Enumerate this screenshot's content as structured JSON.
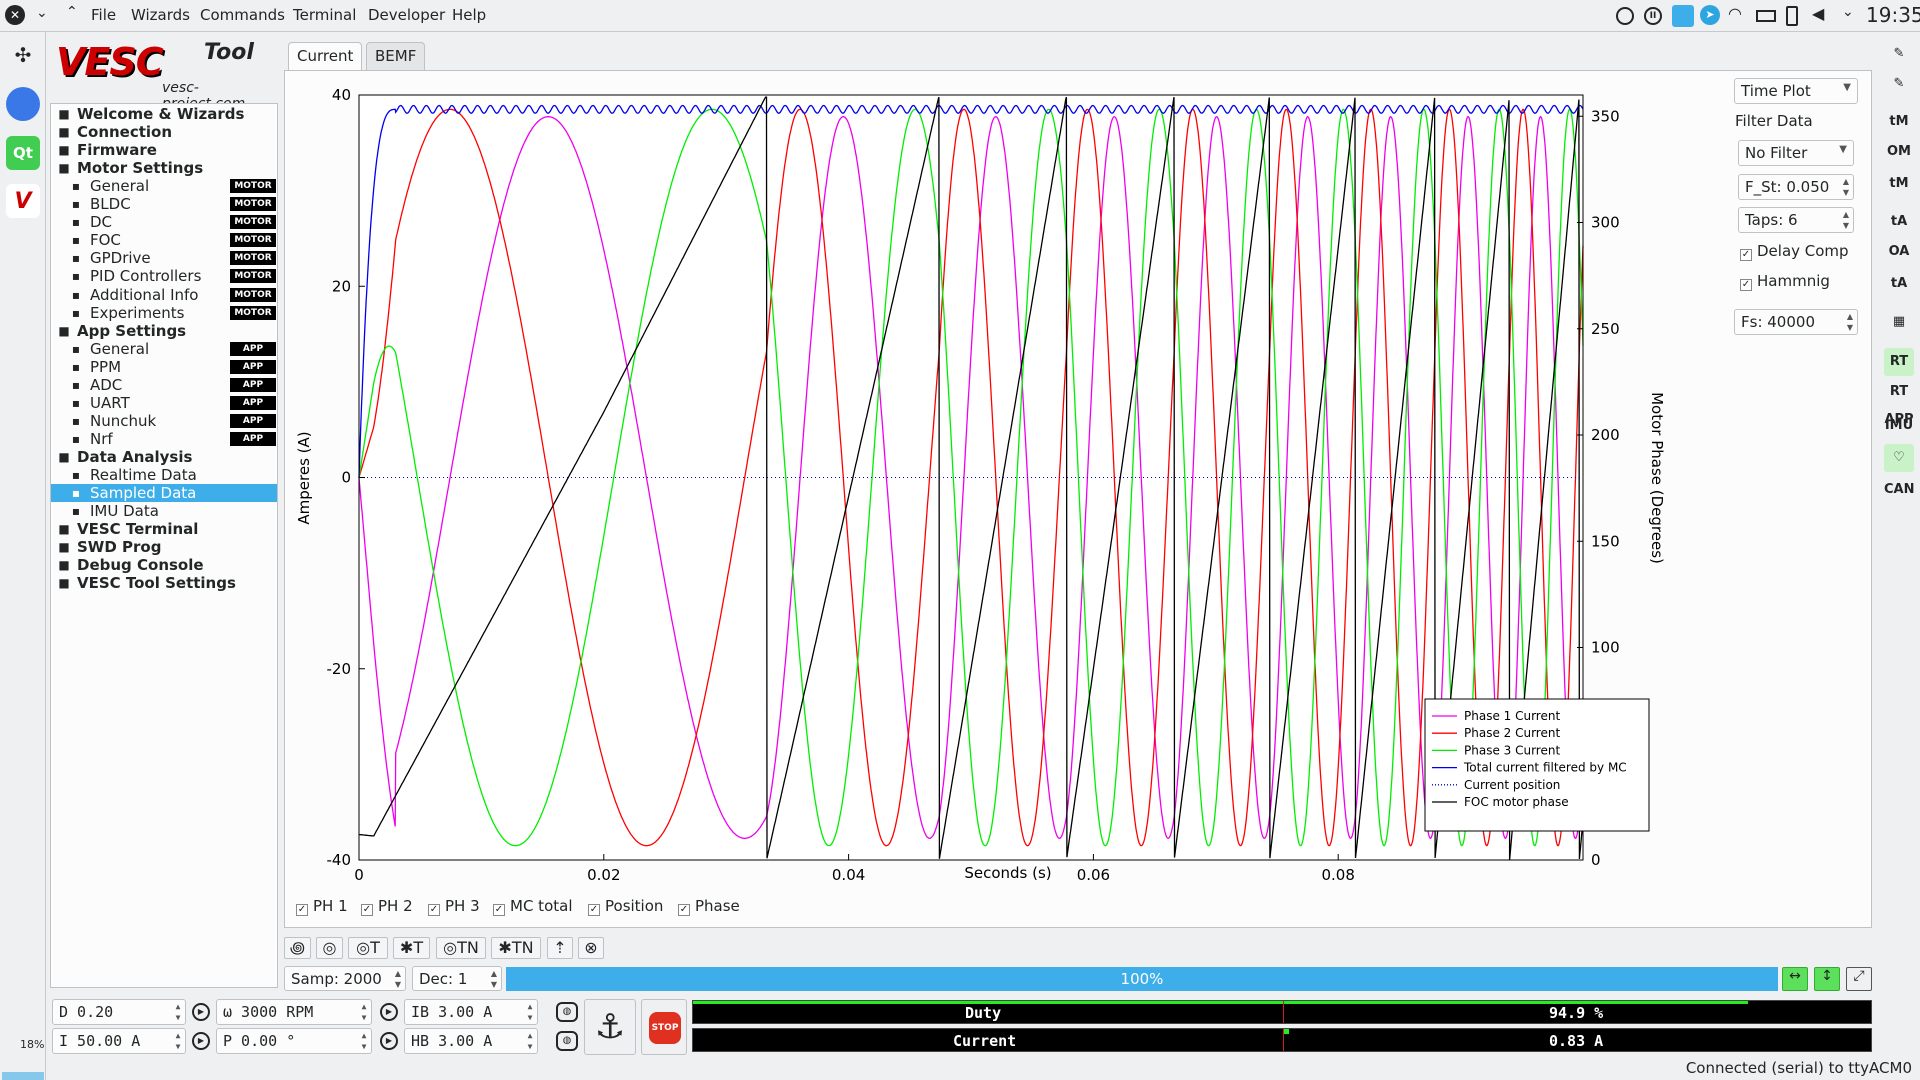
{
  "menubar": {
    "items": [
      "File",
      "Wizards",
      "Commands",
      "Terminal",
      "Developer",
      "Help"
    ],
    "clock": "19:35"
  },
  "logo": {
    "brand": "VESC",
    "tool": "Tool",
    "url": "vesc-project.com"
  },
  "sidebar": {
    "items": [
      {
        "label": "Welcome & Wizards",
        "level": "top",
        "icon": "home-icon"
      },
      {
        "label": "Connection",
        "level": "top",
        "icon": "connection-icon"
      },
      {
        "label": "Firmware",
        "level": "top",
        "icon": "firmware-icon"
      },
      {
        "label": "Motor Settings",
        "level": "top",
        "icon": "motor-icon"
      },
      {
        "label": "General",
        "level": "sub",
        "badge": "MOTOR",
        "icon": "sliders-icon"
      },
      {
        "label": "BLDC",
        "level": "sub",
        "badge": "MOTOR",
        "icon": "bldc-icon"
      },
      {
        "label": "DC",
        "level": "sub",
        "badge": "MOTOR",
        "icon": "dc-icon"
      },
      {
        "label": "FOC",
        "level": "sub",
        "badge": "MOTOR",
        "icon": "foc-icon"
      },
      {
        "label": "GPDrive",
        "level": "sub",
        "badge": "MOTOR",
        "icon": "gpdrive-icon"
      },
      {
        "label": "PID Controllers",
        "level": "sub",
        "badge": "MOTOR",
        "icon": "pid-icon"
      },
      {
        "label": "Additional Info",
        "level": "sub",
        "badge": "MOTOR",
        "icon": "info-icon"
      },
      {
        "label": "Experiments",
        "level": "sub",
        "badge": "MOTOR",
        "icon": "experiments-icon"
      },
      {
        "label": "App Settings",
        "level": "top",
        "icon": "app-settings-icon"
      },
      {
        "label": "General",
        "level": "sub",
        "badge": "APP",
        "icon": "sliders-icon"
      },
      {
        "label": "PPM",
        "level": "sub",
        "badge": "APP",
        "icon": "ppm-icon"
      },
      {
        "label": "ADC",
        "level": "sub",
        "badge": "APP",
        "icon": "adc-icon"
      },
      {
        "label": "UART",
        "level": "sub",
        "badge": "APP",
        "icon": "uart-icon"
      },
      {
        "label": "Nunchuk",
        "level": "sub",
        "badge": "APP",
        "icon": "nunchuk-icon"
      },
      {
        "label": "Nrf",
        "level": "sub",
        "badge": "APP",
        "icon": "nrf-icon"
      },
      {
        "label": "Data Analysis",
        "level": "top",
        "icon": "data-analysis-icon"
      },
      {
        "label": "Realtime Data",
        "level": "sub",
        "icon": "realtime-icon"
      },
      {
        "label": "Sampled Data",
        "level": "sub",
        "selected": true,
        "icon": "sampled-icon"
      },
      {
        "label": "IMU Data",
        "level": "sub",
        "icon": "imu-icon"
      },
      {
        "label": "VESC Terminal",
        "level": "top",
        "icon": "terminal-icon"
      },
      {
        "label": "SWD Prog",
        "level": "top",
        "icon": "swd-icon"
      },
      {
        "label": "Debug Console",
        "level": "top",
        "icon": "debug-icon"
      },
      {
        "label": "VESC Tool Settings",
        "level": "top",
        "icon": "settings-icon"
      }
    ]
  },
  "tabs": [
    {
      "label": "Current",
      "active": true
    },
    {
      "label": "BEMF",
      "active": false
    }
  ],
  "plot_settings": {
    "plot_mode": "Time Plot",
    "filter_data_label": "Filter Data",
    "filter": "No Filter",
    "f_st": "F_St: 0.050",
    "taps": "Taps: 6",
    "delay_comp": "Delay Comp",
    "hamming": "Hammnig",
    "fs": "Fs: 40000"
  },
  "checkboxes": [
    "PH 1",
    "PH 2",
    "PH 3",
    "MC total",
    "Position",
    "Phase"
  ],
  "sample_tools": [
    "TN",
    "TN",
    "T",
    "T"
  ],
  "samp": "Samp: 2000",
  "dec": "Dec: 1",
  "progress": {
    "value": 100,
    "label": "100%"
  },
  "controls": {
    "duty": "D 0.20",
    "current": "I 50.00 A",
    "rpm": "ω 3000 RPM",
    "pos": "P 0.00 °",
    "ib": "IB 3.00 A",
    "hb": "HB 3.00 A",
    "stop": "STOP"
  },
  "meters": [
    {
      "name": "Duty",
      "value": "94.9 %",
      "fraction": 0.949
    },
    {
      "name": "Current",
      "value": "0.83 A",
      "fraction": 0.008
    }
  ],
  "status": "Connected (serial) to ttyACM0",
  "launcher_cpu": "18%",
  "right_toolbar": [
    "tM",
    "OM",
    "tM",
    "tA",
    "OA",
    "tA",
    "RT",
    "RT APP",
    "IMU",
    "CAN"
  ],
  "chart_data": {
    "type": "line",
    "xlabel": "Seconds (s)",
    "ylabel": "Amperes (A)",
    "y2label": "Motor Phase (Degrees)",
    "xlim": [
      0,
      0.1
    ],
    "ylim": [
      -40,
      40
    ],
    "y2lim": [
      0,
      360
    ],
    "xticks": [
      "0",
      "0.02",
      "0.04",
      "0.06",
      "0.08"
    ],
    "yticks": [
      "-40",
      "-20",
      "0",
      "20",
      "40"
    ],
    "y2ticks": [
      "0",
      "50",
      "100",
      "150",
      "200",
      "250",
      "300",
      "350"
    ],
    "legend_position": "bottom-right",
    "series": [
      {
        "name": "Phase 1 Current",
        "color": "#ee00ee",
        "axis": "left"
      },
      {
        "name": "Phase 2 Current",
        "color": "#ff0000",
        "axis": "left"
      },
      {
        "name": "Phase 3 Current",
        "color": "#00ee00",
        "axis": "left"
      },
      {
        "name": "Total current filtered by MC",
        "color": "#0000ee",
        "axis": "left"
      },
      {
        "name": "Current position",
        "color": "#0000cc",
        "axis": "left",
        "dotted": true
      },
      {
        "name": "FOC motor phase",
        "color": "#000000",
        "axis": "right"
      }
    ],
    "signal": {
      "amplitude": 38.5,
      "total_current": 38.5,
      "phase_crossings_s": [
        0.0333,
        0.0474,
        0.0578,
        0.0666,
        0.0744,
        0.0814,
        0.0879,
        0.094,
        0.0997
      ]
    }
  }
}
